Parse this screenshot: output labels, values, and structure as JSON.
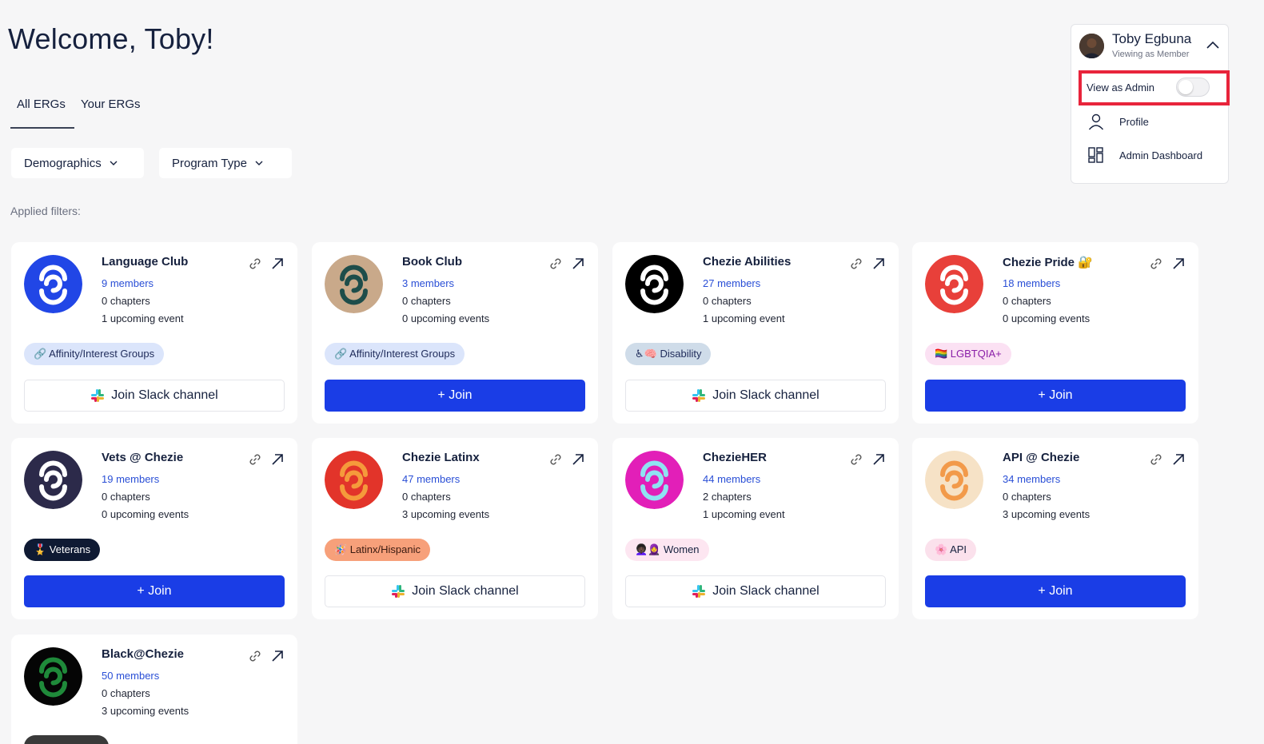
{
  "header": {
    "welcome": "Welcome, Toby!"
  },
  "tabs": [
    {
      "label": "All ERGs"
    },
    {
      "label": "Your ERGs"
    }
  ],
  "filters": {
    "demographics": "Demographics",
    "program_type": "Program Type",
    "applied_label": "Applied filters:"
  },
  "user_menu": {
    "name": "Toby Egbuna",
    "role": "Viewing as Member",
    "view_as_admin_label": "View as Admin",
    "view_as_admin_on": false,
    "profile_label": "Profile",
    "admin_dashboard_label": "Admin Dashboard"
  },
  "cards": [
    {
      "title": "Language Club",
      "members": "9 members",
      "chapters": "0 chapters",
      "events": "1 upcoming event",
      "tag": "🔗 Affinity/Interest Groups",
      "action": "Join Slack channel",
      "action_type": "slack",
      "logo_bg": "#2146e6",
      "logo_fg": "#ffffff",
      "tag_bg": "#dbe5fb",
      "tag_color": "#1f2b5a"
    },
    {
      "title": "Book Club",
      "members": "3 members",
      "chapters": "0 chapters",
      "events": "0 upcoming events",
      "tag": "🔗 Affinity/Interest Groups",
      "action": "+ Join",
      "action_type": "join",
      "logo_bg": "#c9a98a",
      "logo_fg": "#1e4d4a",
      "tag_bg": "#dbe5fb",
      "tag_color": "#1f2b5a"
    },
    {
      "title": "Chezie Abilities",
      "members": "27 members",
      "chapters": "0 chapters",
      "events": "1 upcoming event",
      "tag": "♿🧠 Disability",
      "action": "Join Slack channel",
      "action_type": "slack",
      "logo_bg": "#000000",
      "logo_fg": "#ffffff",
      "tag_bg": "#cfdce9",
      "tag_color": "#1f2b5a"
    },
    {
      "title": "Chezie Pride 🔐",
      "members": "18 members",
      "chapters": "0 chapters",
      "events": "0 upcoming events",
      "tag": "🏳️‍🌈 LGBTQIA+",
      "action": "+ Join",
      "action_type": "join",
      "logo_bg": "#e8403a",
      "logo_fg": "#ffffff",
      "tag_bg": "#fbe1f3",
      "tag_color": "#8a1fa8"
    },
    {
      "title": "Vets @ Chezie",
      "members": "19 members",
      "chapters": "0 chapters",
      "events": "0 upcoming events",
      "tag": "🎖️ Veterans",
      "action": "+ Join",
      "action_type": "join",
      "logo_bg": "#2c2a4a",
      "logo_fg": "#ffffff",
      "tag_bg": "#0f1a33",
      "tag_color": "#ffffff"
    },
    {
      "title": "Chezie Latinx",
      "members": "47 members",
      "chapters": "0 chapters",
      "events": "3 upcoming events",
      "tag": "🪅 Latinx/Hispanic",
      "action": "Join Slack channel",
      "action_type": "slack",
      "logo_bg": "#e2342a",
      "logo_fg": "#f59a3b",
      "tag_bg": "#f7a07a",
      "tag_color": "#3a1a10"
    },
    {
      "title": "ChezieHER",
      "members": "44 members",
      "chapters": "2 chapters",
      "events": "1 upcoming event",
      "tag": "👩🏿‍🦱🧕 Women",
      "action": "Join Slack channel",
      "action_type": "slack",
      "logo_bg": "#e21fb8",
      "logo_fg": "#8fe3f2",
      "tag_bg": "#fde6f1",
      "tag_color": "#16213e"
    },
    {
      "title": "API @ Chezie",
      "members": "34 members",
      "chapters": "0 chapters",
      "events": "3 upcoming events",
      "tag": "🌸 API",
      "action": "+ Join",
      "action_type": "join",
      "logo_bg": "#f6e2c6",
      "logo_fg": "#f29a4a",
      "tag_bg": "#fbe1ec",
      "tag_color": "#16213e"
    },
    {
      "title": "Black@Chezie",
      "members": "50 members",
      "chapters": "0 chapters",
      "events": "3 upcoming events",
      "tag": "",
      "action": "",
      "action_type": "none",
      "logo_bg": "#050505",
      "logo_fg": "#1f8a3a",
      "tag_bg": "#3a3a3a",
      "tag_color": "#ffffff"
    }
  ]
}
